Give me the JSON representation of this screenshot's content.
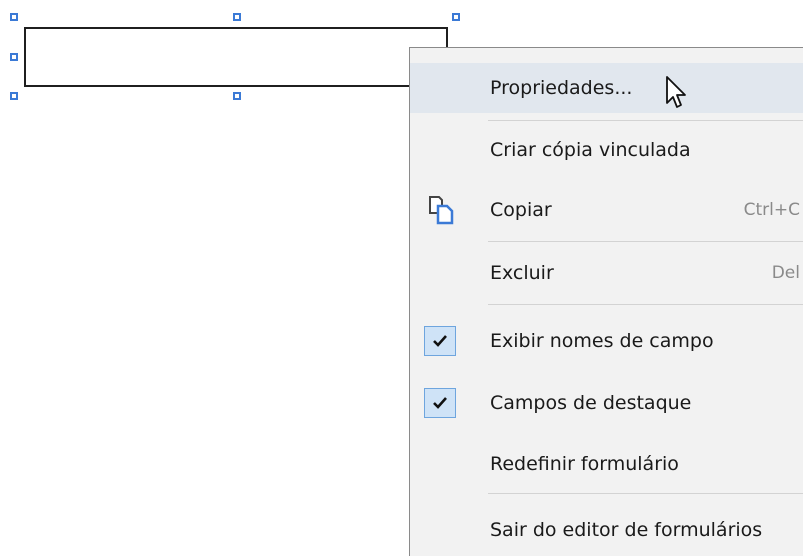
{
  "menu": {
    "items": [
      {
        "label": "Propriedades...",
        "shortcut": "",
        "checked": false,
        "icon": "",
        "hover": true
      },
      {
        "label": "Criar cópia vinculada",
        "shortcut": "",
        "checked": false,
        "icon": ""
      },
      {
        "label": "Copiar",
        "shortcut": "Ctrl+C",
        "checked": false,
        "icon": "copy-icon"
      },
      {
        "label": "Excluir",
        "shortcut": "Del",
        "checked": false,
        "icon": ""
      },
      {
        "label": "Exibir nomes de campo",
        "shortcut": "",
        "checked": true,
        "icon": "check-icon"
      },
      {
        "label": "Campos de destaque",
        "shortcut": "",
        "checked": true,
        "icon": "check-icon"
      },
      {
        "label": "Redefinir formulário",
        "shortcut": "",
        "checked": false,
        "icon": ""
      },
      {
        "label": "Sair do editor de formulários",
        "shortcut": "",
        "checked": false,
        "icon": ""
      }
    ]
  },
  "colors": {
    "menu_background": "#f2f2f2",
    "hover_background": "#e1e7ee",
    "check_background": "#cfe3f7",
    "check_border": "#6ea5de",
    "handle_color": "#3b7ad6",
    "copy_icon_color": "#3b7ad6"
  },
  "icons": [
    "copy-icon",
    "check-icon",
    "mouse-pointer-icon",
    "resize-handle"
  ]
}
